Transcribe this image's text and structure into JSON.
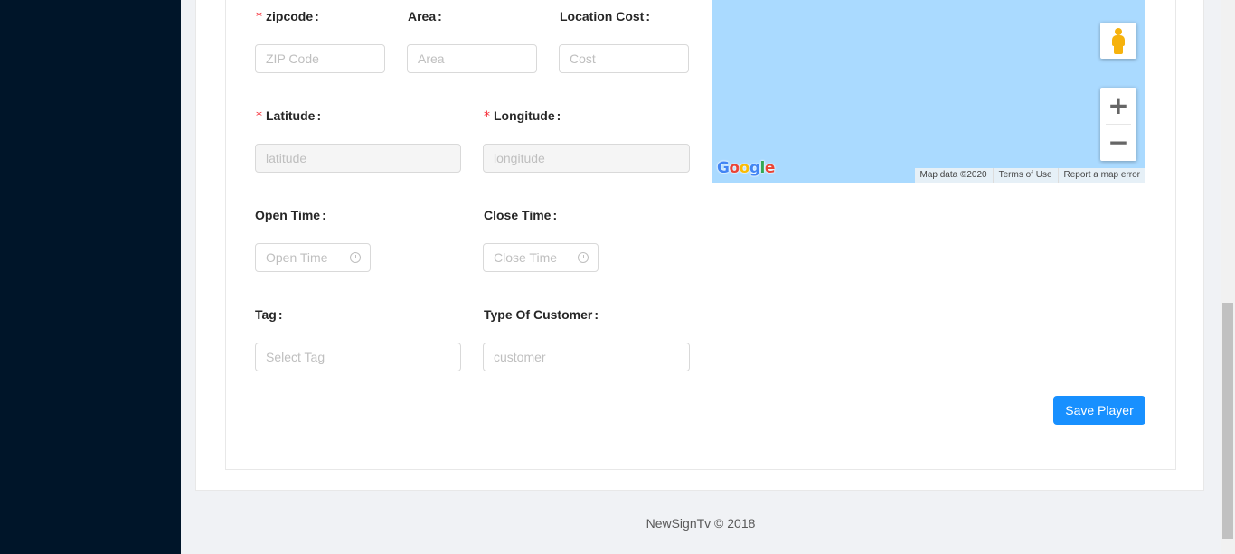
{
  "form": {
    "zipcode": {
      "label": "zipcode",
      "required": true,
      "placeholder": "ZIP Code"
    },
    "area": {
      "label": "Area",
      "required": false,
      "placeholder": "Area"
    },
    "location_cost": {
      "label": "Location Cost",
      "required": false,
      "placeholder": "Cost"
    },
    "latitude": {
      "label": "Latitude",
      "required": true,
      "placeholder": "latitude"
    },
    "longitude": {
      "label": "Longitude",
      "required": true,
      "placeholder": "longitude"
    },
    "open_time": {
      "label": "Open Time",
      "placeholder": "Open Time"
    },
    "close_time": {
      "label": "Close Time",
      "placeholder": "Close Time"
    },
    "tag": {
      "label": "Tag",
      "placeholder": "Select Tag"
    },
    "customer_type": {
      "label": "Type Of Customer",
      "placeholder": "customer"
    },
    "colon": ":",
    "required_mark": "*",
    "save_label": "Save Player"
  },
  "map": {
    "logo": "Google",
    "footer": [
      "Map data ©2020",
      "Terms of Use",
      "Report a map error"
    ],
    "zoom_in": "+",
    "zoom_out": "−"
  },
  "footer": {
    "copyright": "NewSignTv © 2018"
  },
  "colors": {
    "sider": "#001529",
    "primary": "#1890ff",
    "required": "#f5222d",
    "map_water": "#aadaff"
  }
}
